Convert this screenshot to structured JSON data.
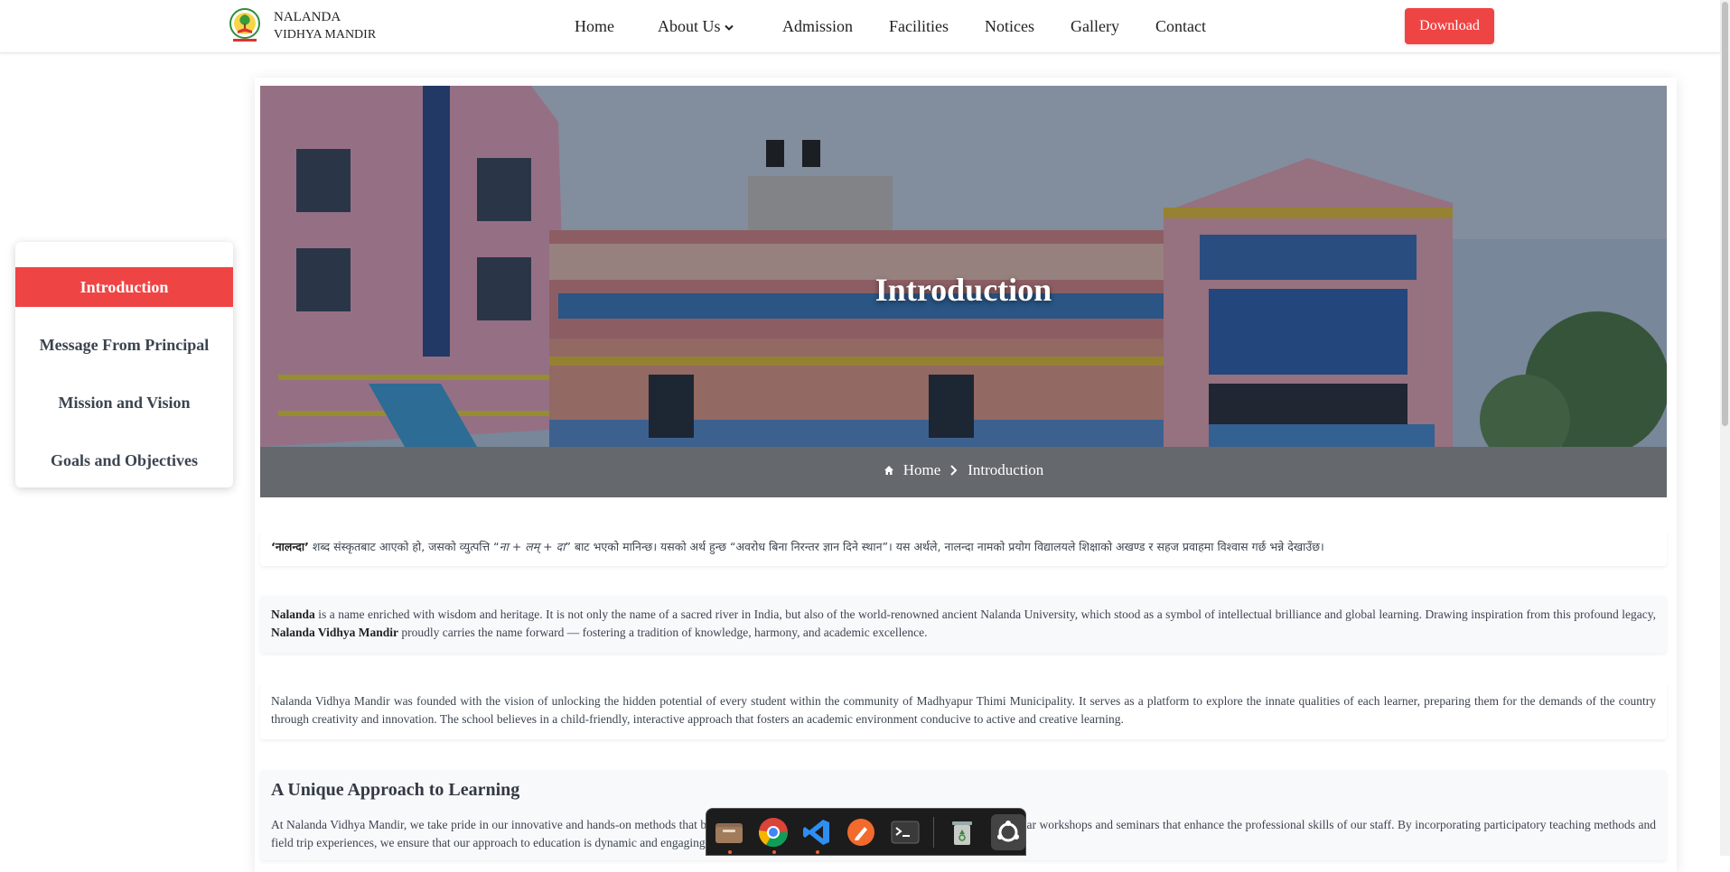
{
  "brand": {
    "line1": "NALANDA",
    "line2": "VIDHYA MANDIR"
  },
  "nav": {
    "home": "Home",
    "about": "About Us",
    "admission": "Admission",
    "facilities": "Facilities",
    "notices": "Notices",
    "gallery": "Gallery",
    "contact": "Contact"
  },
  "download_label": "Download",
  "sidebar": {
    "items": [
      "Introduction",
      "Message From Principal",
      "Mission and Vision",
      "Goals and Objectives"
    ]
  },
  "hero": {
    "title": "Introduction",
    "crumb_home": "Home",
    "crumb_current": "Introduction"
  },
  "intro_np": {
    "bold": "‘नालन्दा’",
    "before_italic": " शब्द संस्कृतबाट आएको हो, जसको व्युत्पत्ति “",
    "italic": "ना + लम् + दा",
    "after_italic": "” बाट भएको मानिन्छ। यसको अर्थ हुन्छ “अवरोध बिना निरन्तर ज्ञान दिने स्थान”। यस अर्थले, नालन्दा नामको प्रयोग विद्यालयले शिक्षाको अखण्ड र सहज प्रवाहमा विश्वास गर्छ भन्ने देखाउँछ।"
  },
  "para2": {
    "bold1": "Nalanda",
    "text1": " is a name enriched with wisdom and heritage. It is not only the name of a sacred river in India, but also of the world-renowned ancient Nalanda University, which stood as a symbol of intellectual brilliance and global learning. Drawing inspiration from this profound legacy, ",
    "bold2": "Nalanda Vidhya Mandir",
    "text2": " proudly carries the name forward — fostering a tradition of knowledge, harmony, and academic excellence."
  },
  "para3": "Nalanda Vidhya Mandir was founded with the vision of unlocking the hidden potential of every student within the community of Madhyapur Thimi Municipality. It serves as a platform to explore the innate qualities of each learner, preparing them for the demands of the country through creativity and innovation. The school believes in a child-friendly, interactive approach that fosters an academic environment conducive to active and creative learning.",
  "section4": {
    "heading": "A Unique Approach to Learning",
    "text": "At Nalanda Vidhya Mandir, we take pride in our innovative and hands-on methods that bring learning to life for every student. We regularly conduct regular workshops and seminars that enhance the professional skills of our staff. By incorporating participatory teaching methods and field trip experiences, we ensure that our approach to education is dynamic and engaging."
  },
  "dock": {
    "items": [
      "files-icon",
      "chrome-icon",
      "vscode-icon",
      "pen-tool-icon",
      "terminal-icon",
      "trash-icon",
      "apps-icon"
    ]
  }
}
